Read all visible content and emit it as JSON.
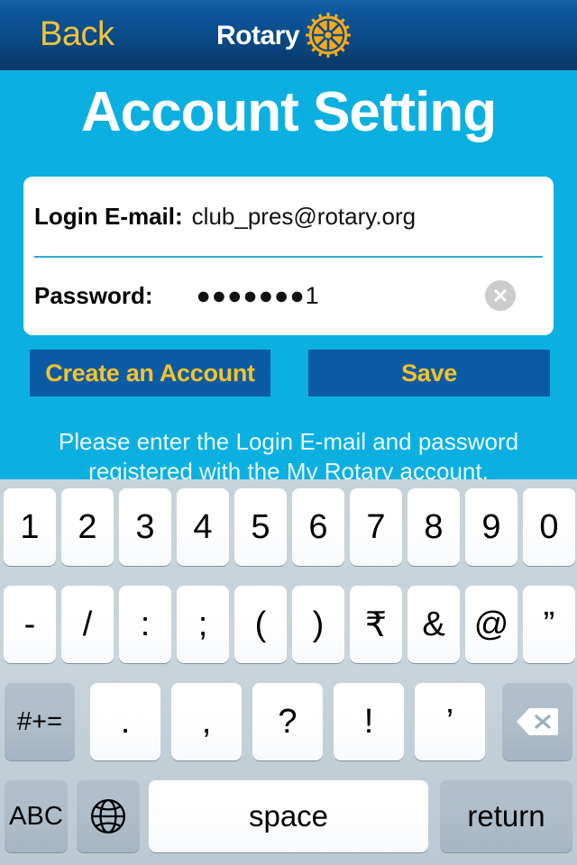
{
  "navbar": {
    "back_label": "Back",
    "brand_text": "Rotary",
    "brand_icon": "rotary-gear-icon",
    "gradient_top": "#1463a8",
    "gradient_bottom": "#093a6a"
  },
  "page": {
    "title": "Account Setting",
    "background": "#0CB0E0"
  },
  "form": {
    "email": {
      "label": "Login E-mail:",
      "value": "club_pres@rotary.org",
      "placeholder": "Login E-mail"
    },
    "password": {
      "label": "Password:",
      "value": "●●●●●●●1",
      "placeholder": "Password",
      "clear_icon": "clear-circle-x-icon"
    },
    "divider_color": "#2CACC8"
  },
  "actions": {
    "create_label": "Create an Account",
    "save_label": "Save",
    "button_bg": "#0B5BA4",
    "button_text_color": "#F5C22B"
  },
  "helper": {
    "text": "Please enter the Login E-mail and password registered with the My Rotary account."
  },
  "keyboard": {
    "background": "#c7d3da",
    "row1": [
      "1",
      "2",
      "3",
      "4",
      "5",
      "6",
      "7",
      "8",
      "9",
      "0"
    ],
    "row2": [
      "-",
      "/",
      ":",
      ";",
      "(",
      ")",
      "₹",
      "&",
      "@",
      "”"
    ],
    "row3": {
      "symbols_key": "#+=",
      "keys": [
        ".",
        ",",
        "?",
        "!",
        "’"
      ],
      "backspace_icon": "backspace-delete-icon"
    },
    "row4": {
      "abc_key": "ABC",
      "globe_icon": "globe-language-icon",
      "space_key": "space",
      "return_key": "return"
    }
  }
}
